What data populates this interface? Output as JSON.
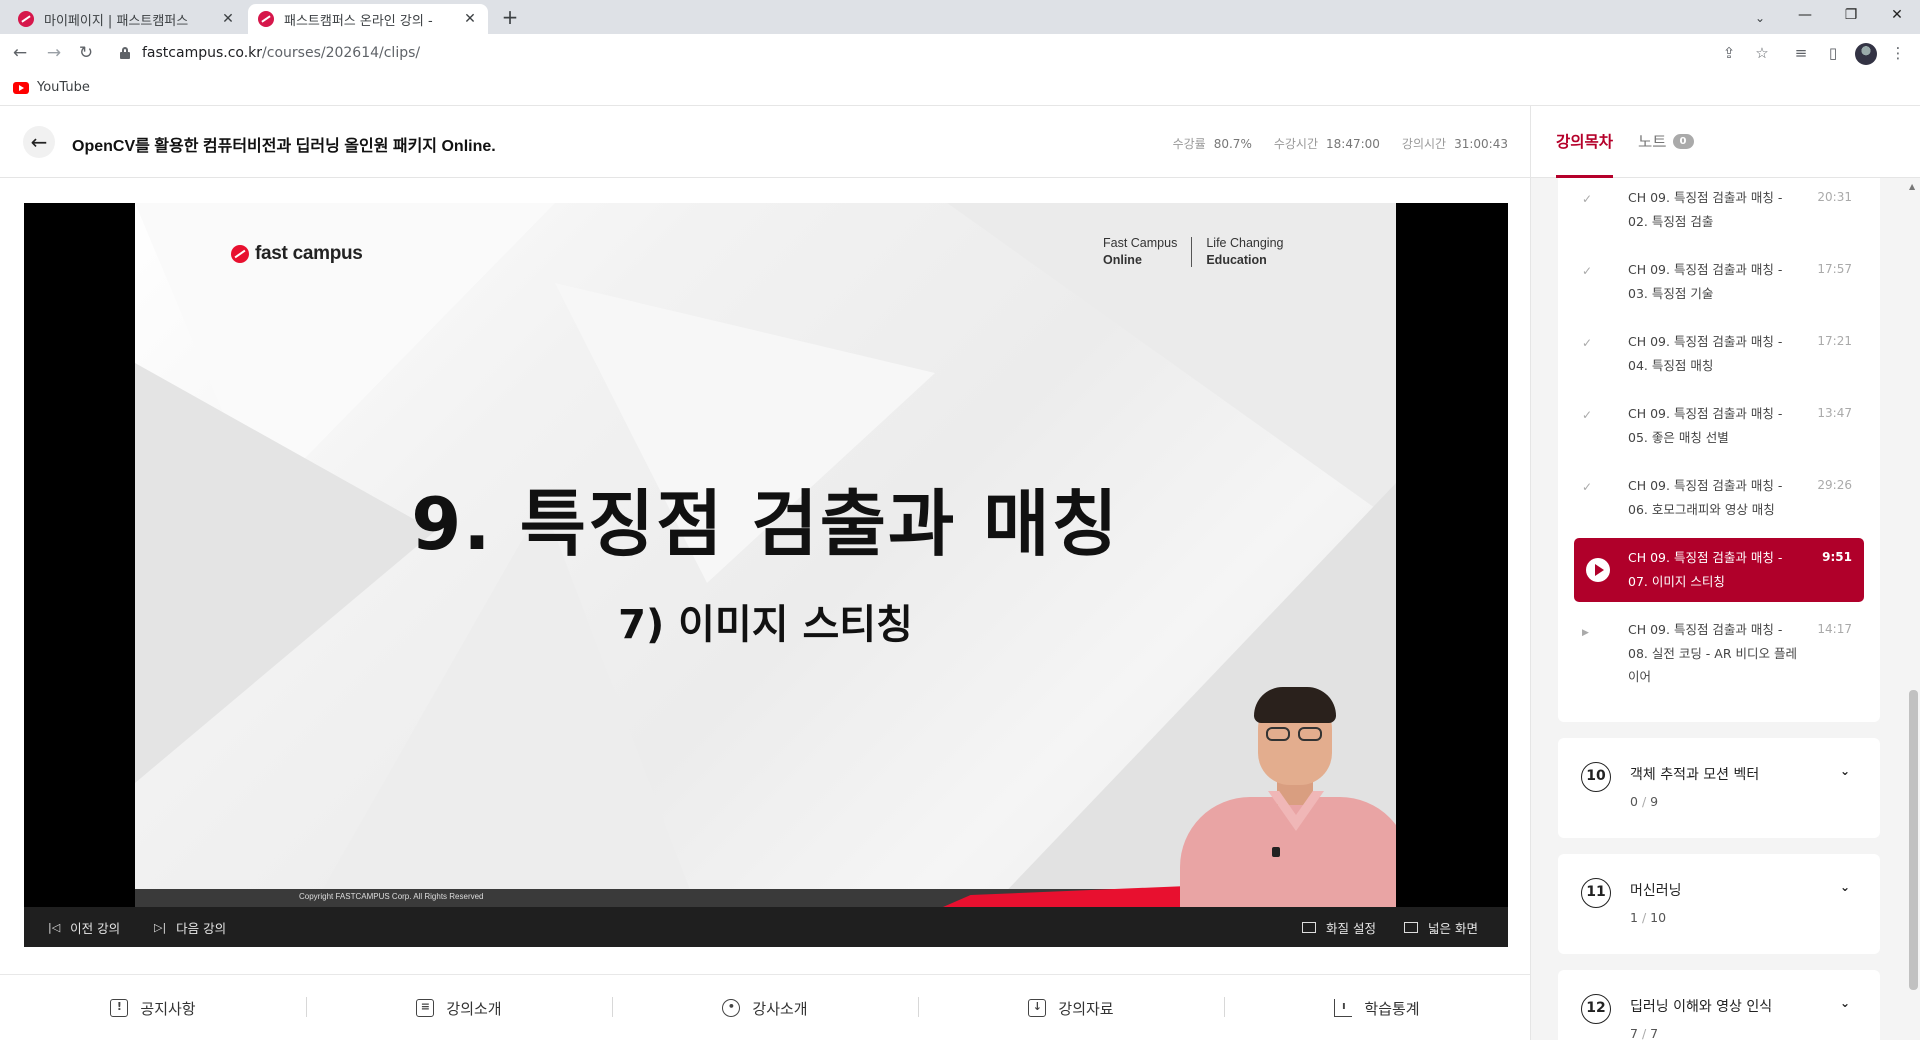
{
  "browser": {
    "tabs": [
      {
        "title": "마이페이지 | 패스트캠퍼스",
        "active": false
      },
      {
        "title": "패스트캠퍼스 온라인 강의 -",
        "active": true
      }
    ],
    "url_domain": "fastcampus.co.kr",
    "url_path": "/courses/202614/clips/",
    "bookmark_youtube": "YouTube",
    "icons": {
      "back": "arrow-left-icon",
      "forward": "arrow-right-icon",
      "reload": "reload-icon",
      "share": "share-icon",
      "star": "star-icon",
      "media": "media-controls-icon",
      "sidepanel": "side-panel-icon",
      "menu": "kebab-menu-icon"
    }
  },
  "header": {
    "course_title": "OpenCV를 활용한 컴퓨터비전과 딥러닝 올인원 패키지 Online.",
    "stats": [
      {
        "label": "수강률",
        "value": "80.7%"
      },
      {
        "label": "수강시간",
        "value": "18:47:00"
      },
      {
        "label": "강의시간",
        "value": "31:00:43"
      }
    ]
  },
  "slide": {
    "logo_text": "fast campus",
    "corner_left_1": "Fast Campus",
    "corner_left_2": "Online",
    "corner_right_1": "Life Changing",
    "corner_right_2": "Education",
    "title": "9. 특징점 검출과 매칭",
    "subtitle": "7) 이미지 스티칭",
    "copyright": "Copyright FASTCAMPUS Corp. All Rights Reserved"
  },
  "player_controls": {
    "prev": "이전 강의",
    "next": "다음 강의",
    "quality": "화질 설정",
    "wide": "넓은 화면"
  },
  "bottom_tabs": [
    "공지사항",
    "강의소개",
    "강사소개",
    "강의자료",
    "학습통계"
  ],
  "sidebar": {
    "tab_toc": "강의목차",
    "tab_notes": "노트",
    "notes_count": "0",
    "clips": [
      {
        "title": "CH 09. 특징점 검출과 매칭 - 02. 특징점 검출",
        "duration": "20:31",
        "state": "done"
      },
      {
        "title": "CH 09. 특징점 검출과 매칭 - 03. 특징점 기술",
        "duration": "17:57",
        "state": "done"
      },
      {
        "title": "CH 09. 특징점 검출과 매칭 - 04. 특징점 매칭",
        "duration": "17:21",
        "state": "done"
      },
      {
        "title": "CH 09. 특징점 검출과 매칭 - 05. 좋은 매칭 선별",
        "duration": "13:47",
        "state": "done"
      },
      {
        "title": "CH 09. 특징점 검출과 매칭 - 06. 호모그래피와 영상 매칭",
        "duration": "29:26",
        "state": "done"
      },
      {
        "title": "CH 09. 특징점 검출과 매칭 - 07. 이미지 스티칭",
        "duration": "9:51",
        "state": "current"
      },
      {
        "title": "CH 09. 특징점 검출과 매칭 - 08. 실전 코딩 - AR 비디오 플레이어",
        "duration": "14:17",
        "state": "todo"
      }
    ],
    "chapters": [
      {
        "number": "10",
        "title": "객체 추적과 모션 벡터",
        "done": "0",
        "total": "9"
      },
      {
        "number": "11",
        "title": "머신러닝",
        "done": "1",
        "total": "10"
      },
      {
        "number": "12",
        "title": "딥러닝 이해와 영상 인식",
        "done": "7",
        "total": "7"
      }
    ]
  },
  "colors": {
    "accent": "#b0002a",
    "slide_red": "#e8102f",
    "player_bar": "#1f1f1f"
  }
}
